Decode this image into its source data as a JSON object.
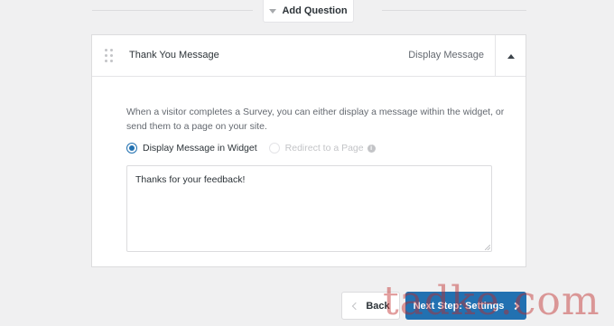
{
  "add_question": {
    "label": "Add Question",
    "icon": "caret-down-icon"
  },
  "card": {
    "title": "Thank You Message",
    "type_label": "Display Message",
    "toggle_icon": "caret-up-icon",
    "description": "When a visitor completes a Survey, you can either display a message within the widget, or send them to a page on your site.",
    "options": [
      {
        "label": "Display Message in Widget",
        "selected": true
      },
      {
        "label": "Redirect to a Page",
        "selected": false,
        "disabled": true
      }
    ],
    "info_icon": "info-icon",
    "message_value": "Thanks for your feedback!"
  },
  "footer": {
    "back_label": "Back",
    "next_label": "Next Step: Settings"
  },
  "watermark": {
    "text": "tadke.com"
  },
  "colors": {
    "accent": "#2271b1",
    "background": "#f0f0f1",
    "border": "#dcdcde"
  }
}
